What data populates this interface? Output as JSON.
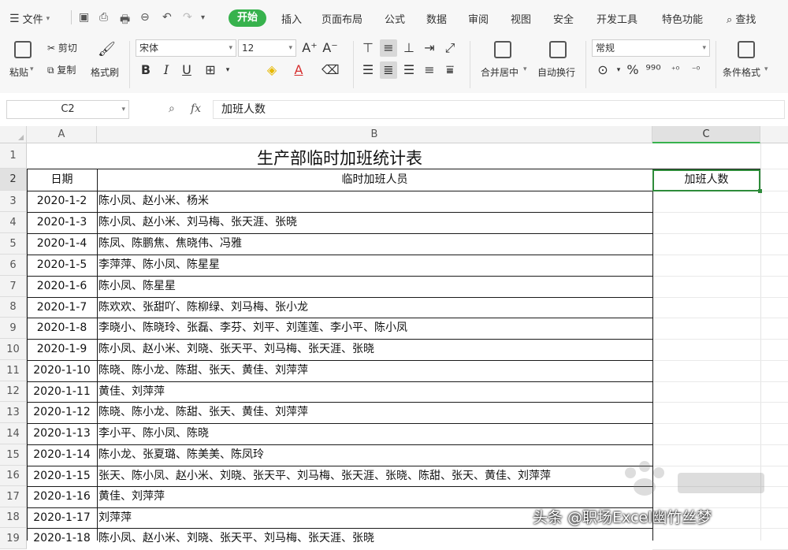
{
  "menu": {
    "file": "文件",
    "tabs": [
      "开始",
      "插入",
      "页面布局",
      "公式",
      "数据",
      "审阅",
      "视图",
      "安全",
      "开发工具",
      "特色功能"
    ],
    "active_tab": "开始",
    "search": "查找"
  },
  "ribbon": {
    "paste": "粘贴",
    "cut": "剪切",
    "copy": "复制",
    "format_painter": "格式刷",
    "font_name": "宋体",
    "font_size": "12",
    "merge_center": "合并居中",
    "wrap_text": "自动换行",
    "number_format": "常规",
    "conditional_format": "条件格式",
    "bold": "B",
    "italic": "I",
    "underline": "U",
    "grow_font": "A⁺",
    "shrink_font": "A⁻",
    "percent": "%"
  },
  "formula_bar": {
    "name_box": "C2",
    "fx": "fx",
    "content": "加班人数"
  },
  "columns": [
    "A",
    "B",
    "C"
  ],
  "sheet": {
    "title": "生产部临时加班统计表",
    "headers": {
      "date": "日期",
      "staff": "临时加班人员",
      "count": "加班人数"
    },
    "rows": [
      {
        "n": "3",
        "date": "2020-1-2",
        "staff": "陈小凤、赵小米、杨米"
      },
      {
        "n": "4",
        "date": "2020-1-3",
        "staff": "陈小凤、赵小米、刘马梅、张天涯、张晓"
      },
      {
        "n": "5",
        "date": "2020-1-4",
        "staff": "陈凤、陈鹏焦、焦晓伟、冯雅"
      },
      {
        "n": "6",
        "date": "2020-1-5",
        "staff": "李萍萍、陈小凤、陈星星"
      },
      {
        "n": "7",
        "date": "2020-1-6",
        "staff": "陈小凤、陈星星"
      },
      {
        "n": "8",
        "date": "2020-1-7",
        "staff": "陈欢欢、张甜吖、陈柳绿、刘马梅、张小龙"
      },
      {
        "n": "9",
        "date": "2020-1-8",
        "staff": "李晓小、陈晓玲、张磊、李芬、刘平、刘莲莲、李小平、陈小凤"
      },
      {
        "n": "10",
        "date": "2020-1-9",
        "staff": "陈小凤、赵小米、刘晓、张天平、刘马梅、张天涯、张晓"
      },
      {
        "n": "11",
        "date": "2020-1-10",
        "staff": "陈晓、陈小龙、陈甜、张天、黄佳、刘萍萍"
      },
      {
        "n": "12",
        "date": "2020-1-11",
        "staff": "黄佳、刘萍萍"
      },
      {
        "n": "13",
        "date": "2020-1-12",
        "staff": "陈晓、陈小龙、陈甜、张天、黄佳、刘萍萍"
      },
      {
        "n": "14",
        "date": "2020-1-13",
        "staff": "李小平、陈小凤、陈晓"
      },
      {
        "n": "15",
        "date": "2020-1-14",
        "staff": "陈小龙、张夏璐、陈美美、陈凤玲"
      },
      {
        "n": "16",
        "date": "2020-1-15",
        "staff": "张天、陈小凤、赵小米、刘晓、张天平、刘马梅、张天涯、张晓、陈甜、张天、黄佳、刘萍萍"
      },
      {
        "n": "17",
        "date": "2020-1-16",
        "staff": "黄佳、刘萍萍"
      },
      {
        "n": "18",
        "date": "2020-1-17",
        "staff": "刘萍萍"
      },
      {
        "n": "19",
        "date": "2020-1-18",
        "staff": "陈小凤、赵小米、刘晓、张天平、刘马梅、张天涯、张晓"
      }
    ]
  },
  "watermark": "头条 @职场Excel幽竹丝梦",
  "colors": {
    "accent": "#37b24d",
    "selection_border": "#2e8b3a"
  }
}
